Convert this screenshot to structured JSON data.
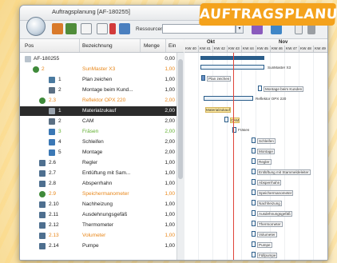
{
  "banner": "AUFTRAGSPLANUNG",
  "window": {
    "title": "Auftragsplanung [AF-180255]"
  },
  "toolbar": {
    "ressourcen_label": "Ressourcen:",
    "ressourcen_value": ""
  },
  "columns": {
    "pos": "Pos",
    "bezeichnung": "Bezeichnung",
    "menge": "Menge",
    "ein": "Ein"
  },
  "gantt": {
    "months": [
      "Okt",
      "Nov"
    ],
    "weeks": [
      "KW 40",
      "KW 41",
      "KW 42",
      "KW 43",
      "KW 44",
      "KW 45",
      "KW 46",
      "KW 47",
      "KW 48",
      "KW 49"
    ]
  },
  "rows": [
    {
      "pos": "AF-180255",
      "name": "",
      "qty": "0,00",
      "style": ""
    },
    {
      "pos": "2",
      "name": "SunMaster X3",
      "qty": "1,00",
      "style": "orange"
    },
    {
      "pos": "1",
      "name": "Plan zeichen",
      "qty": "1,00",
      "style": ""
    },
    {
      "pos": "2",
      "name": "Montage beim Kund...",
      "qty": "1,00",
      "style": ""
    },
    {
      "pos": "2.3",
      "name": "Reflektor OPX 220",
      "qty": "2,00",
      "style": "orange"
    },
    {
      "pos": "1",
      "name": "Materialzukauf",
      "qty": "2,00",
      "style": "selected"
    },
    {
      "pos": "2",
      "name": "CAM",
      "qty": "2,00",
      "style": ""
    },
    {
      "pos": "3",
      "name": "Fräsen",
      "qty": "2,00",
      "style": "green"
    },
    {
      "pos": "4",
      "name": "Schleifen",
      "qty": "2,00",
      "style": ""
    },
    {
      "pos": "5",
      "name": "Montage",
      "qty": "2,00",
      "style": ""
    },
    {
      "pos": "2.6",
      "name": "Regler",
      "qty": "1,00",
      "style": ""
    },
    {
      "pos": "2.7",
      "name": "Entlüftung mit Sam...",
      "qty": "1,00",
      "style": ""
    },
    {
      "pos": "2.8",
      "name": "Absperrhahn",
      "qty": "1,00",
      "style": ""
    },
    {
      "pos": "2.9",
      "name": "Speichermanometer",
      "qty": "1,00",
      "style": "orange"
    },
    {
      "pos": "2.10",
      "name": "Nachheizung",
      "qty": "1,00",
      "style": ""
    },
    {
      "pos": "2.11",
      "name": "Ausdehnungsgefäß",
      "qty": "1,00",
      "style": ""
    },
    {
      "pos": "2.12",
      "name": "Thermometer",
      "qty": "1,00",
      "style": ""
    },
    {
      "pos": "2.13",
      "name": "Volumeter",
      "qty": "1,00",
      "style": "orange"
    },
    {
      "pos": "2.14",
      "name": "Pumpe",
      "qty": "1,00",
      "style": ""
    }
  ],
  "gantt_labels": {
    "sunmaster": "SunMaster X3",
    "plan": "Plan zeichen",
    "montage_kunden": "Montage beim Kunden",
    "reflektor": "Reflektor OPX 220",
    "material": "Materialzukauf",
    "cam": "CAM",
    "fraesen": "Fräsen",
    "schleifen": "Schleifen",
    "montage": "Montage",
    "regler": "Regler",
    "entlueftung": "Entlüftung mit Stammeldeleiter",
    "absperrhahn": "Absperrhahn",
    "speicher": "Speichermanometer",
    "nachheizung": "Nachheizung",
    "ausdehnung": "Ausdehnungsgefäß",
    "thermometer": "Thermometer",
    "volumeter": "Volumeter",
    "pumpe": "Pumpe",
    "fuellpumpe": "Füllpumpe"
  }
}
